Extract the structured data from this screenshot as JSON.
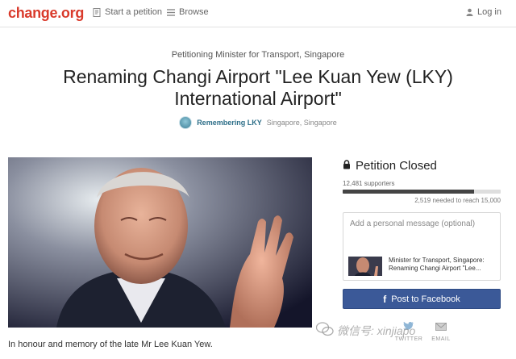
{
  "brand": {
    "logo_text": "change.org",
    "logo_color": "#d93a2b"
  },
  "nav": {
    "start_petition": "Start a petition",
    "browse": "Browse",
    "login": "Log in"
  },
  "petition": {
    "petitioning": "Petitioning Minister for Transport, Singapore",
    "title": "Renaming Changi Airport \"Lee Kuan Yew (LKY) International Airport\"",
    "author_name": "Remembering LKY",
    "author_location": "Singapore, Singapore",
    "caption": "In honour and memory of the late Mr Lee Kuan Yew."
  },
  "status": {
    "closed_label": "Petition Closed",
    "supporters": "12,481 supporters",
    "needed": "2,519 needed to reach 15,000",
    "progress_fraction": 0.832
  },
  "message": {
    "placeholder": "Add a personal message (optional)",
    "preview_text": "Minister for Transport, Singapore: Renaming Changi Airport \"Lee..."
  },
  "share": {
    "facebook_label": "Post to Facebook",
    "twitter_label": "TWITTER",
    "email_label": "EMAIL"
  },
  "watermark": {
    "text": "微信号: xinjiapo"
  },
  "colors": {
    "facebook": "#3b5998",
    "link": "#2c6e88",
    "progress": "#444444"
  },
  "icons": {
    "start_petition": "petition-icon",
    "browse": "list-icon",
    "login": "user-icon",
    "closed": "lock-icon",
    "twitter": "twitter-bird-icon",
    "email": "envelope-icon",
    "wechat": "wechat-icon"
  }
}
